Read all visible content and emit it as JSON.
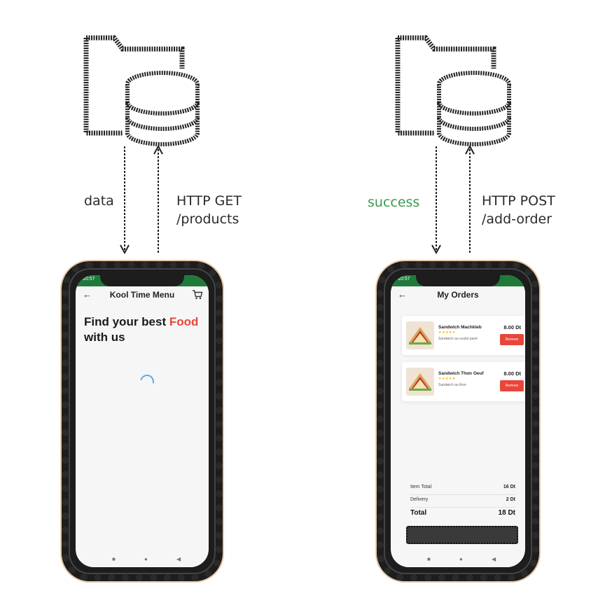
{
  "diagram": {
    "left_flow": {
      "down_label": "data",
      "up_label_line1": "HTTP GET",
      "up_label_line2": "/products"
    },
    "right_flow": {
      "down_label": "success",
      "up_label_line1": "HTTP POST",
      "up_label_line2": "/add-order"
    },
    "icons": {
      "storage": "folder-database-icon"
    },
    "colors": {
      "success": "#3a9a4e",
      "accent": "#e8463a",
      "status_bar": "#1f7a3a"
    }
  },
  "phone_left": {
    "status_time": "10:57",
    "title": "Kool Time Menu",
    "headline_part1": "Find your best ",
    "headline_accent": "Food",
    "headline_part2": "with us",
    "icons": {
      "back": "arrow-left-icon",
      "cart": "cart-icon",
      "loading": "spinner-icon"
    },
    "nav": [
      "■",
      "●",
      "◀"
    ]
  },
  "phone_right": {
    "status_time": "10:57",
    "title": "My Orders",
    "orders": [
      {
        "name": "Sandwich Machkleb",
        "stars": "★★★★★",
        "desc": "Sandwich au coulet pané",
        "price": "8.00 Dt",
        "action": "Remove"
      },
      {
        "name": "Sandwich Thon Oeuf",
        "stars": "★★★★★",
        "desc": "Sandwich au thon",
        "price": "8.00 Dt",
        "action": "Remove"
      }
    ],
    "summary": [
      {
        "label": "Item Total",
        "value": "16 Dt"
      },
      {
        "label": "Delivery",
        "value": "2 Dt"
      },
      {
        "label": "Total",
        "value": "18 Dt"
      }
    ],
    "nav": [
      "■",
      "●",
      "◀"
    ]
  }
}
